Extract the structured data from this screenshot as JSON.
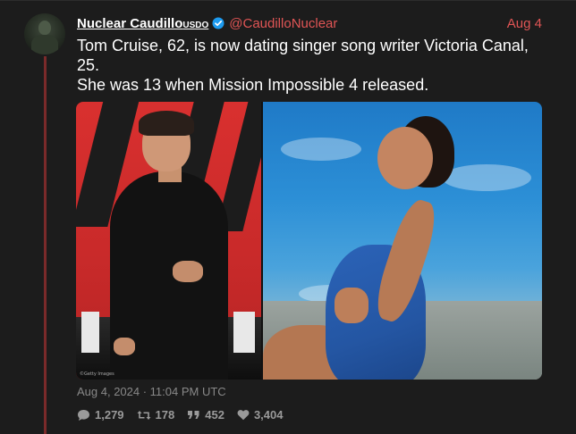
{
  "post": {
    "display_name": "Nuclear Caudillo",
    "name_suffix": "USDO",
    "handle": "@CaudilloNuclear",
    "date": "Aug 4",
    "text_lines": [
      "Tom Cruise, 62, is now dating singer song writer Victoria Canal,",
      "25.",
      "She was 13 when Mission Impossible 4 released."
    ],
    "media": {
      "left_credit": "©Getty Images"
    },
    "timestamp": "Aug 4, 2024 · 11:04 PM UTC",
    "stats": {
      "replies": "1,279",
      "reposts": "178",
      "quotes": "452",
      "likes": "3,404"
    }
  },
  "colors": {
    "accent": "#e05555",
    "thread_line": "#7a2a2a",
    "verified": "#1d9bf0",
    "background": "#1c1c1c"
  },
  "icons": {
    "verified": "verified-badge-icon",
    "replies": "comment-bubble-icon",
    "reposts": "retweet-icon",
    "quotes": "quote-icon",
    "likes": "heart-icon"
  }
}
